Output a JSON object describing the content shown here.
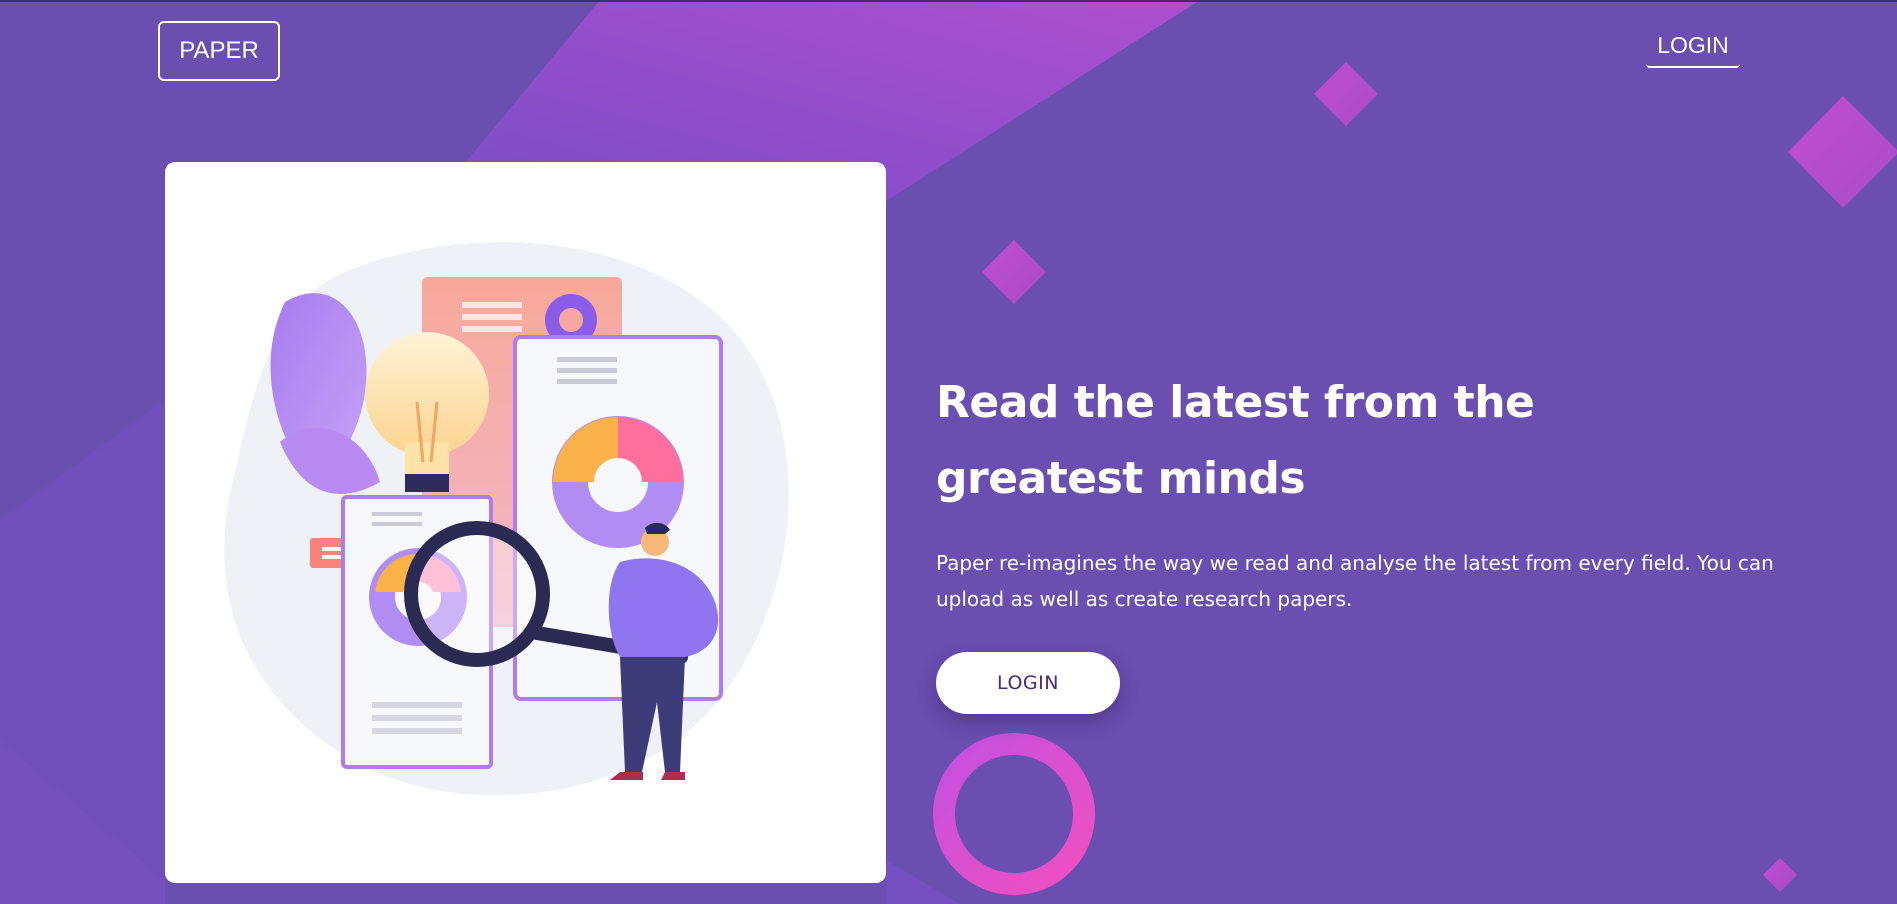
{
  "nav": {
    "brand": "PAPER",
    "login_label": "LOGIN"
  },
  "hero": {
    "headline": "Read the latest from the greatest minds",
    "description": "Paper re-imagines the way we read and analyse the latest from every field. You can upload as well as create research papers.",
    "cta_label": "LOGIN",
    "illustration": "researcher-with-magnifier-illustration"
  },
  "colors": {
    "background": "#6a4eb0",
    "accent_pink": "#d24fd8",
    "accent_purple": "#9b52cf",
    "card_bg": "#ffffff",
    "cta_text": "#4a2a7a"
  }
}
